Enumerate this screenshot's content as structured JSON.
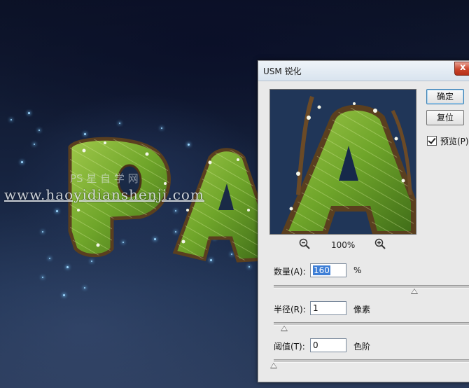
{
  "canvas": {
    "watermark": "www.haoyidianshenji.com",
    "watermark_ps": "PS 星 自 学 网"
  },
  "dialog": {
    "title": "USM 锐化",
    "close_label": "x",
    "ok_label": "确定",
    "reset_label": "复位",
    "preview_label": "预览(P)",
    "preview_checked": true,
    "zoom_value": "100%",
    "fields": {
      "amount": {
        "label": "数量(A):",
        "value": "160",
        "unit": "%",
        "slider_fraction": 0.67
      },
      "radius": {
        "label": "半径(R):",
        "value": "1",
        "unit": "像素",
        "slider_fraction": 0.05
      },
      "threshold": {
        "label": "阈值(T):",
        "value": "0",
        "unit": "色阶",
        "slider_fraction": 0.0
      }
    }
  },
  "colors": {
    "dialog_bg": "#e9e9e9",
    "title_bar": "#dde6f0",
    "close_button": "#c9452c",
    "selection": "#3d7ed6",
    "leaf_green": "#6fa52a"
  }
}
